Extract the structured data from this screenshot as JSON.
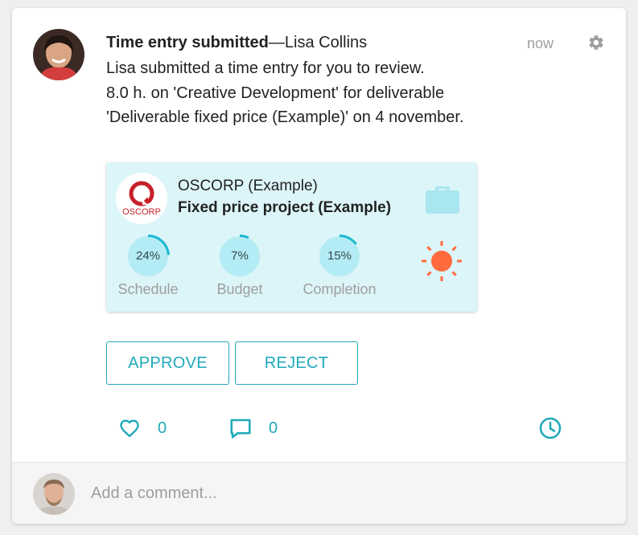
{
  "notification": {
    "title": "Time entry submitted",
    "separator": "—",
    "author": "Lisa Collins",
    "timestamp": "now",
    "body_lines": [
      "Lisa submitted a time entry for you to review.",
      "8.0 h. on 'Creative Development' for deliverable",
      "'Deliverable fixed price (Example)' on 4 november."
    ]
  },
  "project": {
    "client": "OSCORP (Example)",
    "name": "Fixed price project (Example)",
    "logo_text": "OSCORP",
    "metrics": [
      {
        "label": "Schedule",
        "value": 24,
        "display": "24%"
      },
      {
        "label": "Budget",
        "value": 7,
        "display": "7%"
      },
      {
        "label": "Completion",
        "value": 15,
        "display": "15%"
      }
    ],
    "status_icon": "sun-icon"
  },
  "actions": {
    "approve_label": "APPROVE",
    "reject_label": "REJECT",
    "likes": "0",
    "comments": "0"
  },
  "comment_box": {
    "placeholder": "Add a comment..."
  },
  "colors": {
    "accent": "#1ea9b9",
    "project_bg": "#dcf5f8",
    "status_sun": "#ff6b3d",
    "ring_track": "#b3ecf4",
    "ring_fill": "#1ab8d2"
  }
}
